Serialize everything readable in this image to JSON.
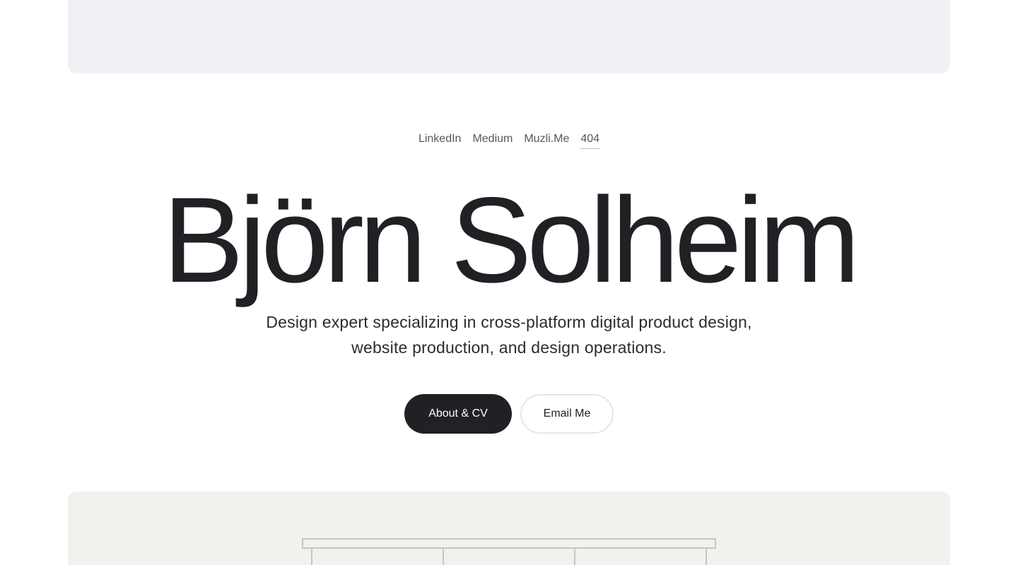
{
  "nav": {
    "links": [
      {
        "label": "LinkedIn"
      },
      {
        "label": "Medium"
      },
      {
        "label": "Muzli.Me"
      },
      {
        "label": "404"
      }
    ]
  },
  "hero": {
    "title": "Björn Solheim",
    "subtitle": "Design expert specializing in cross-platform digital product design, website production, and design operations."
  },
  "actions": {
    "primary_label": "About & CV",
    "secondary_label": "Email Me"
  },
  "colors": {
    "text": "#1f2125",
    "primary_button": "#1f2125",
    "top_panel": "#f1f1f5",
    "bottom_panel": "#f2f1ee"
  }
}
